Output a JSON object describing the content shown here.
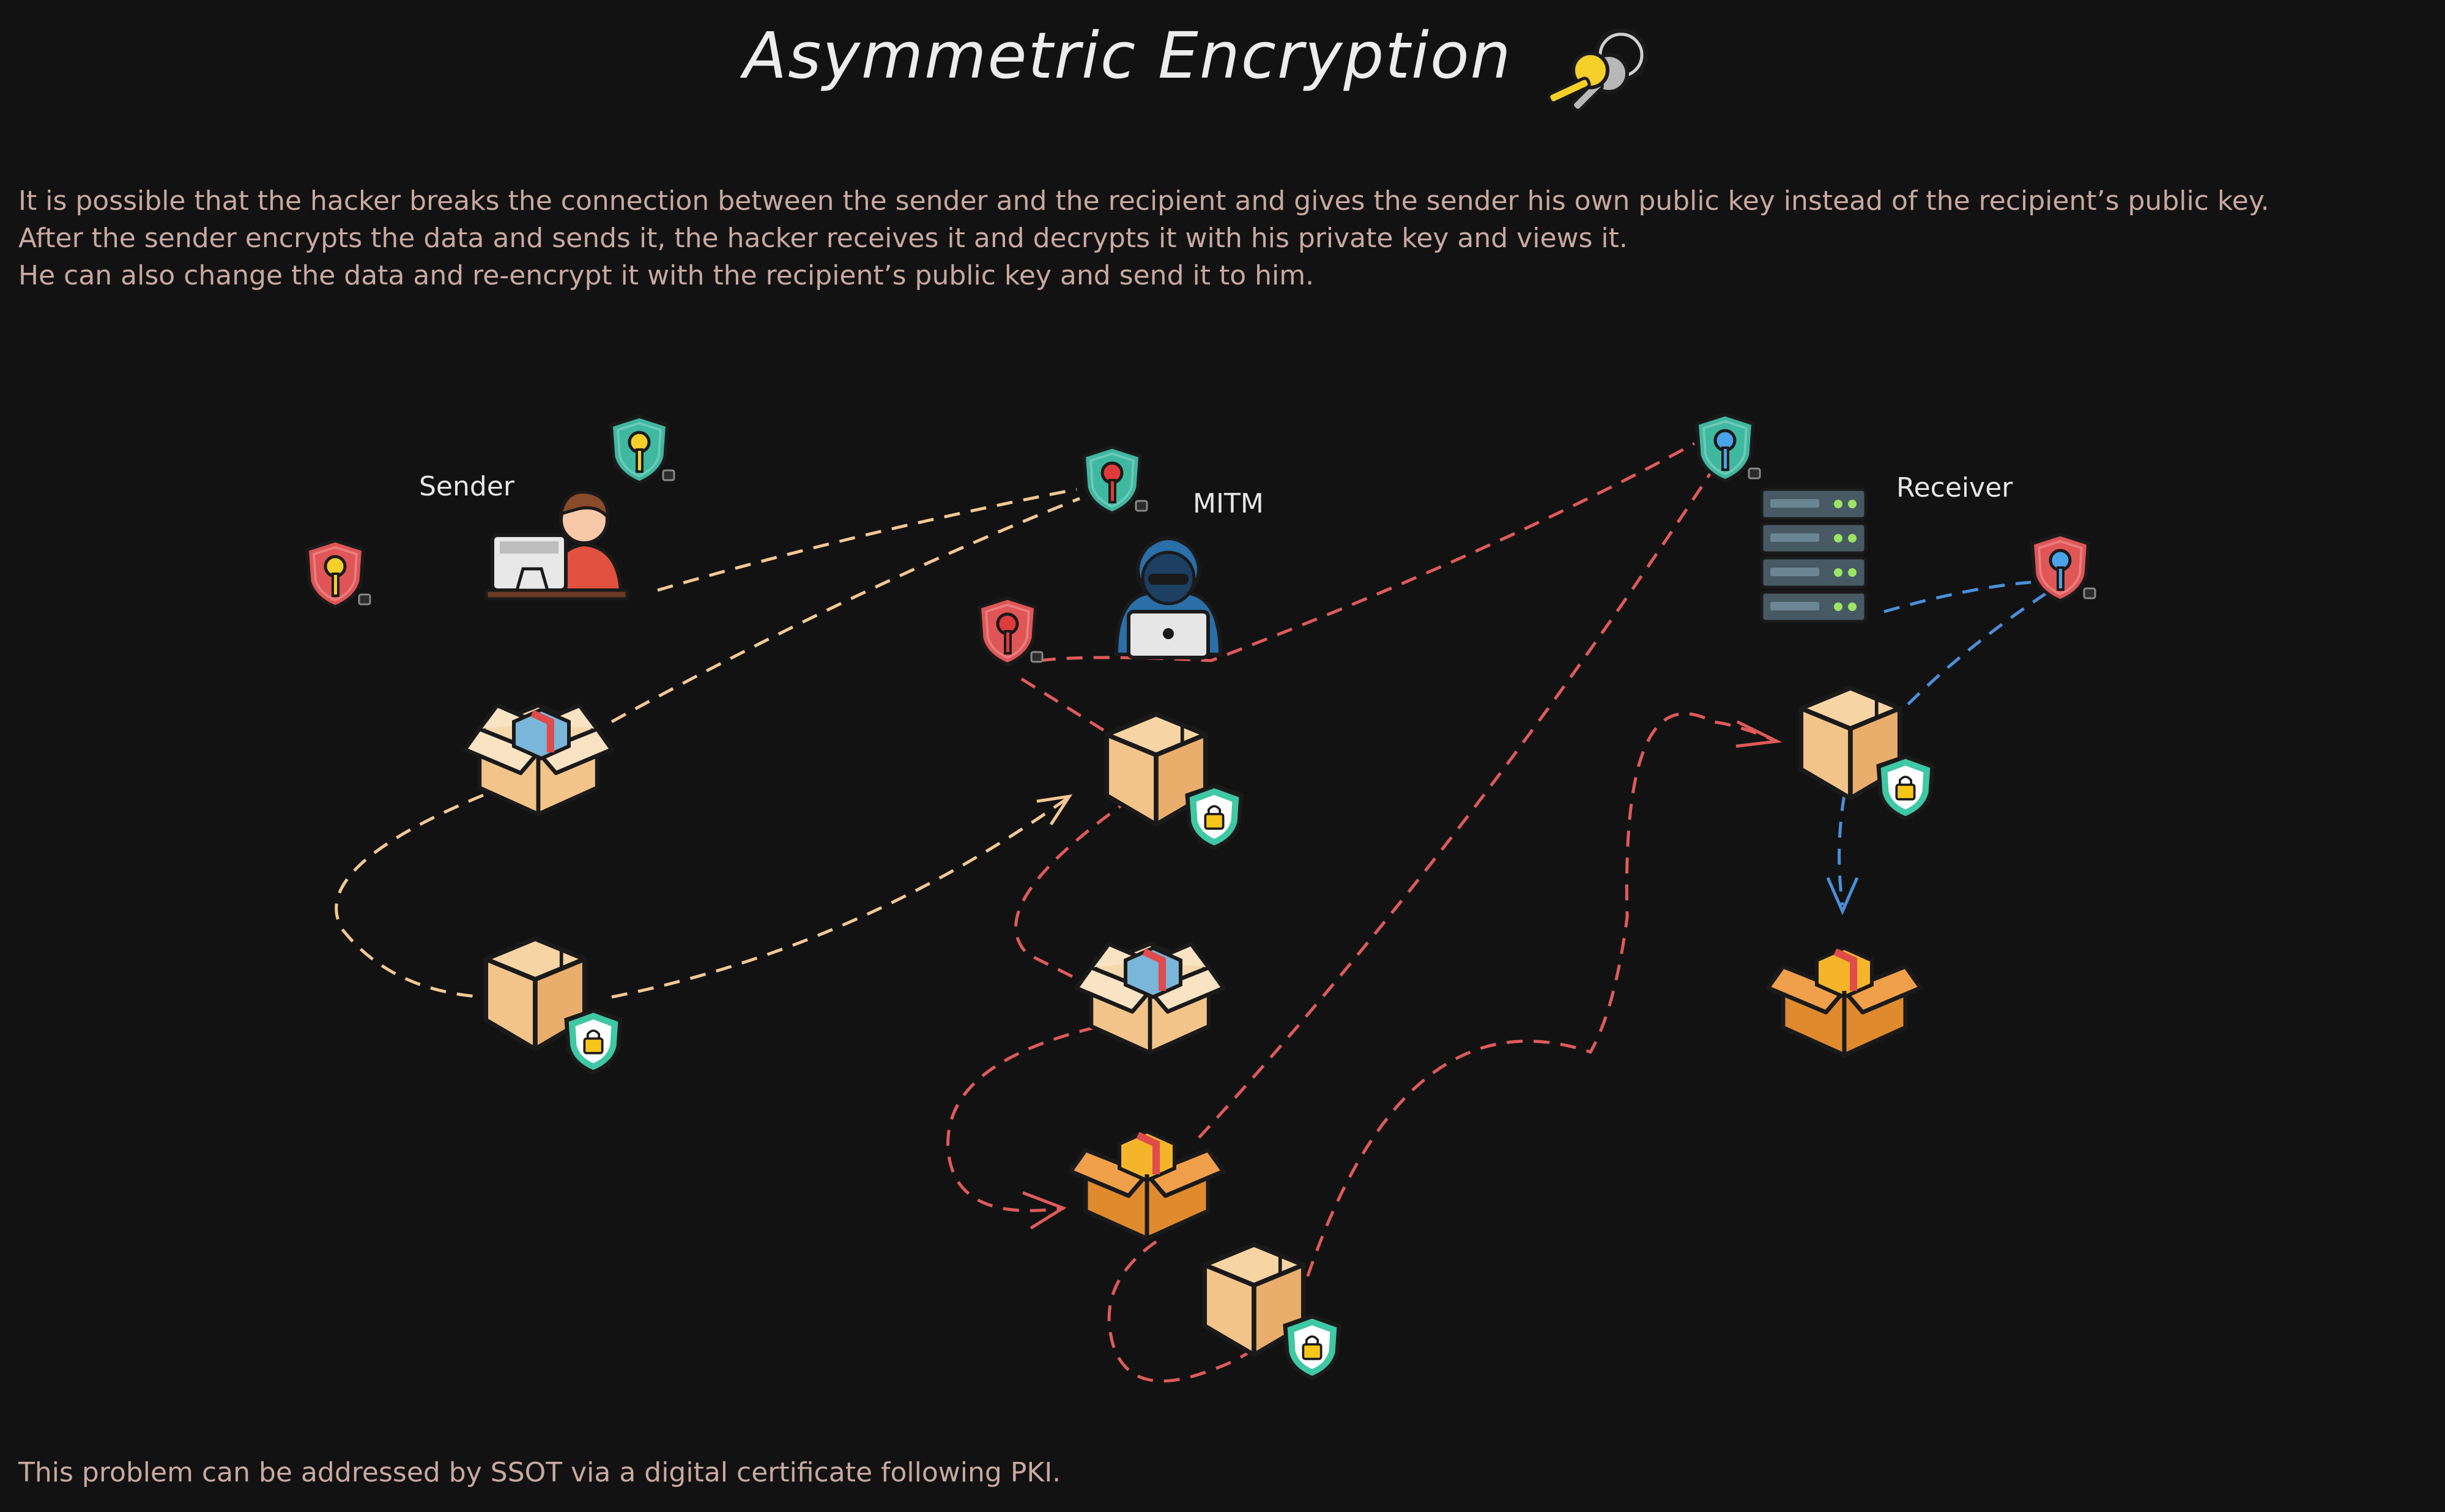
{
  "title": "Asymmetric Encryption",
  "description": [
    "It is possible that the hacker breaks the connection between the sender and the recipient and gives the sender his own public key instead of the recipient’s public key.",
    "After the sender encrypts the data and sends it, the hacker receives it and decrypts it with his private key and views it.",
    "He can also change the data and re-encrypt it with the recipient’s public key and send it to him."
  ],
  "labels": {
    "sender": "Sender",
    "mitm": "MITM",
    "receiver": "Receiver"
  },
  "footer": "This problem can be addressed by SSOT via a digital certificate following PKI.",
  "colors": {
    "background": "#121212",
    "sender_flow": "#f2c894",
    "mitm_flow": "#e05a5a",
    "receiver_flow": "#4a90d9",
    "shield_teal": "#3fb8a0",
    "shield_red": "#e05656",
    "key_yellow": "#f5d02a",
    "key_red": "#e03b3b",
    "key_blue": "#4aa3e8",
    "box": "#f2c48a"
  },
  "icons": {
    "title_icon": "keys-icon",
    "sender": "person-at-computer-icon",
    "mitm": "hooded-hacker-icon",
    "receiver": "server-rack-icon",
    "public_key": "public-key-shield-icon",
    "private_key": "private-key-shield-icon",
    "open_box": "open-box-icon",
    "encrypted_box": "locked-box-icon"
  }
}
